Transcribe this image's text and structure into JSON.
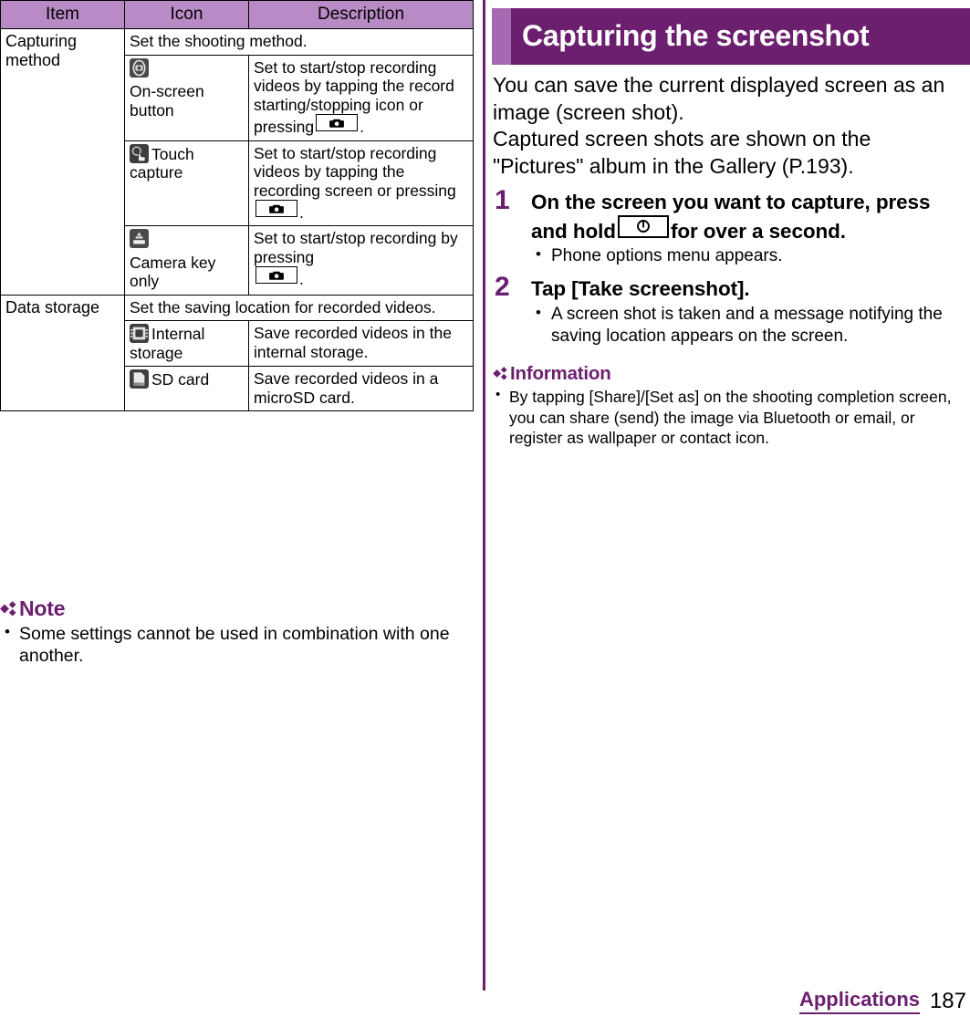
{
  "page": {
    "number": "187",
    "chapter": "Applications"
  },
  "table": {
    "headers": [
      "Item",
      "Icon",
      "Description"
    ],
    "rows": [
      {
        "item": "Capturing method",
        "summary": "Set the shooting method.",
        "options": [
          {
            "icon_name": "on-screen-button-icon",
            "icon_label": "On-screen button",
            "description_pre": "Set to start/stop recording videos by tapping the record starting/stopping icon or pressing",
            "key": "camera-key",
            "description_post": "."
          },
          {
            "icon_name": "touch-capture-icon",
            "icon_label": "Touch capture",
            "description_pre": "Set to start/stop recording videos by tapping the recording screen or pressing",
            "key": "camera-key",
            "description_post": "."
          },
          {
            "icon_name": "camera-key-only-icon",
            "icon_label": "Camera key only",
            "description_pre": "Set to start/stop recording by pressing",
            "key": "camera-key",
            "description_post": "."
          }
        ]
      },
      {
        "item": "Data storage",
        "summary": "Set the saving location for recorded videos.",
        "options": [
          {
            "icon_name": "internal-storage-icon",
            "icon_label": "Internal storage",
            "description_pre": "Save recorded videos in the internal storage.",
            "key": null,
            "description_post": ""
          },
          {
            "icon_name": "sd-card-icon",
            "icon_label": "SD card",
            "description_pre": "Save recorded videos in a microSD card.",
            "key": null,
            "description_post": ""
          }
        ]
      }
    ]
  },
  "note": {
    "heading": "Note",
    "items": [
      "Some settings cannot be used in combination with one another."
    ]
  },
  "section": {
    "title": "Capturing the screenshot",
    "intro_line1": "You can save the current displayed screen as an image (screen shot).",
    "intro_line2": "Captured screen shots are shown on the \"Pictures\" album in the Gallery (P.193)."
  },
  "steps": [
    {
      "number": "1",
      "title_pre": "On the screen you want to capture, press and hold",
      "key": "power-key",
      "title_post": "for over a second.",
      "bullets": [
        "Phone options menu appears."
      ]
    },
    {
      "number": "2",
      "title_pre": "Tap [Take screenshot].",
      "key": null,
      "title_post": "",
      "bullets": [
        "A screen shot is taken and a message notifying the saving location appears on the screen."
      ]
    }
  ],
  "information": {
    "heading": "Information",
    "items": [
      "By tapping [Share]/[Set as] on the shooting completion screen, you can share (send) the image via Bluetooth or email, or register as wallpaper or contact icon."
    ]
  },
  "colors": {
    "accent_purple": "#6b1f6e",
    "header_lavender": "#b98bc6",
    "banner_tab": "#a469b0"
  }
}
